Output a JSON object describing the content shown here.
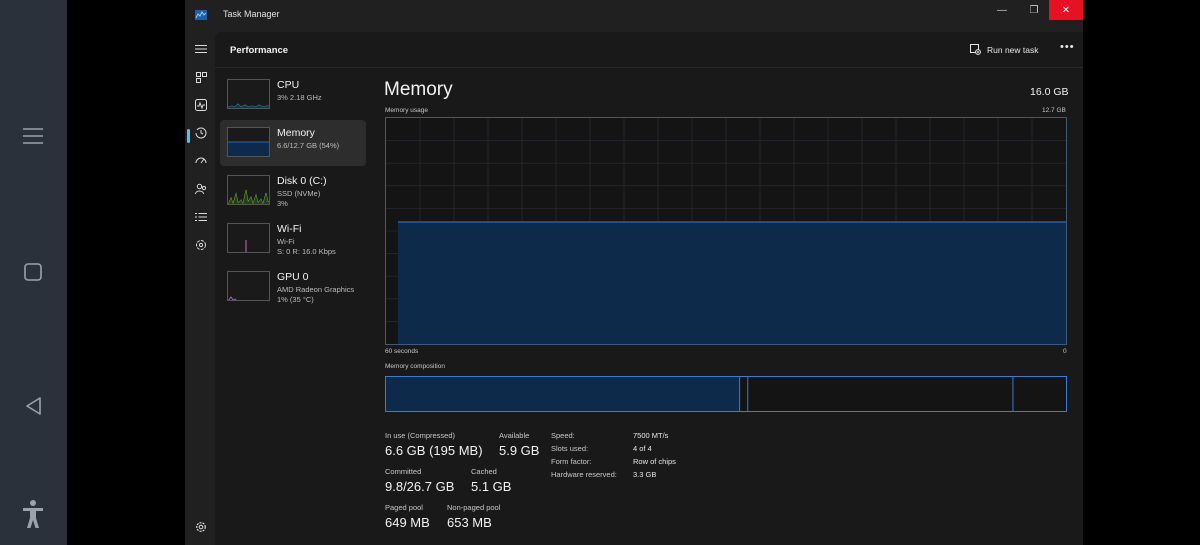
{
  "window": {
    "title": "Task Manager",
    "min_glyph": "—",
    "max_glyph": "❐",
    "close_glyph": "✕"
  },
  "header": {
    "page_title": "Performance",
    "run_new_task": "Run new task",
    "more_glyph": "•••"
  },
  "rail": {
    "icons": [
      "hamburger-icon",
      "processes-icon",
      "performance-icon",
      "app-history-icon",
      "startup-apps-icon",
      "users-icon",
      "details-icon",
      "services-icon",
      "settings-icon"
    ]
  },
  "devices": [
    {
      "name": "CPU",
      "sub1": "3%  2.18 GHz",
      "sub2": ""
    },
    {
      "name": "Memory",
      "sub1": "6.6/12.7 GB (54%)",
      "sub2": ""
    },
    {
      "name": "Disk 0 (C:)",
      "sub1": "SSD (NVMe)",
      "sub2": "3%"
    },
    {
      "name": "Wi-Fi",
      "sub1": "Wi-Fi",
      "sub2": "S: 0  R: 16.0 Kbps"
    },
    {
      "name": "GPU 0",
      "sub1": "AMD Radeon Graphics",
      "sub2": "1%  (35 °C)"
    }
  ],
  "main": {
    "title": "Memory",
    "total": "16.0 GB",
    "usage_label": "Memory usage",
    "usage_max": "12.7 GB",
    "time_left": "60 seconds",
    "time_right": "0",
    "composition_label": "Memory composition",
    "usage_fraction": 0.54
  },
  "composition": {
    "in_use_fraction": 0.52,
    "modified_fraction": 0.012,
    "standby_fraction": 0.39
  },
  "stats": {
    "in_use_label": "In use (Compressed)",
    "in_use_value": "6.6 GB (195 MB)",
    "available_label": "Available",
    "available_value": "5.9 GB",
    "committed_label": "Committed",
    "committed_value": "9.8/26.7 GB",
    "cached_label": "Cached",
    "cached_value": "5.1 GB",
    "paged_label": "Paged pool",
    "paged_value": "649 MB",
    "nonpaged_label": "Non-paged pool",
    "nonpaged_value": "653 MB"
  },
  "details": {
    "speed_label": "Speed:",
    "speed_value": "7500 MT/s",
    "slots_label": "Slots used:",
    "slots_value": "4 of 4",
    "form_label": "Form factor:",
    "form_value": "Row of chips",
    "hwres_label": "Hardware reserved:",
    "hwres_value": "3.3 GB"
  },
  "colors": {
    "accent": "#4cc2ff",
    "memory_fill": "#0e2a4a",
    "memory_line": "#3a7bd5",
    "close_red": "#e81123"
  }
}
